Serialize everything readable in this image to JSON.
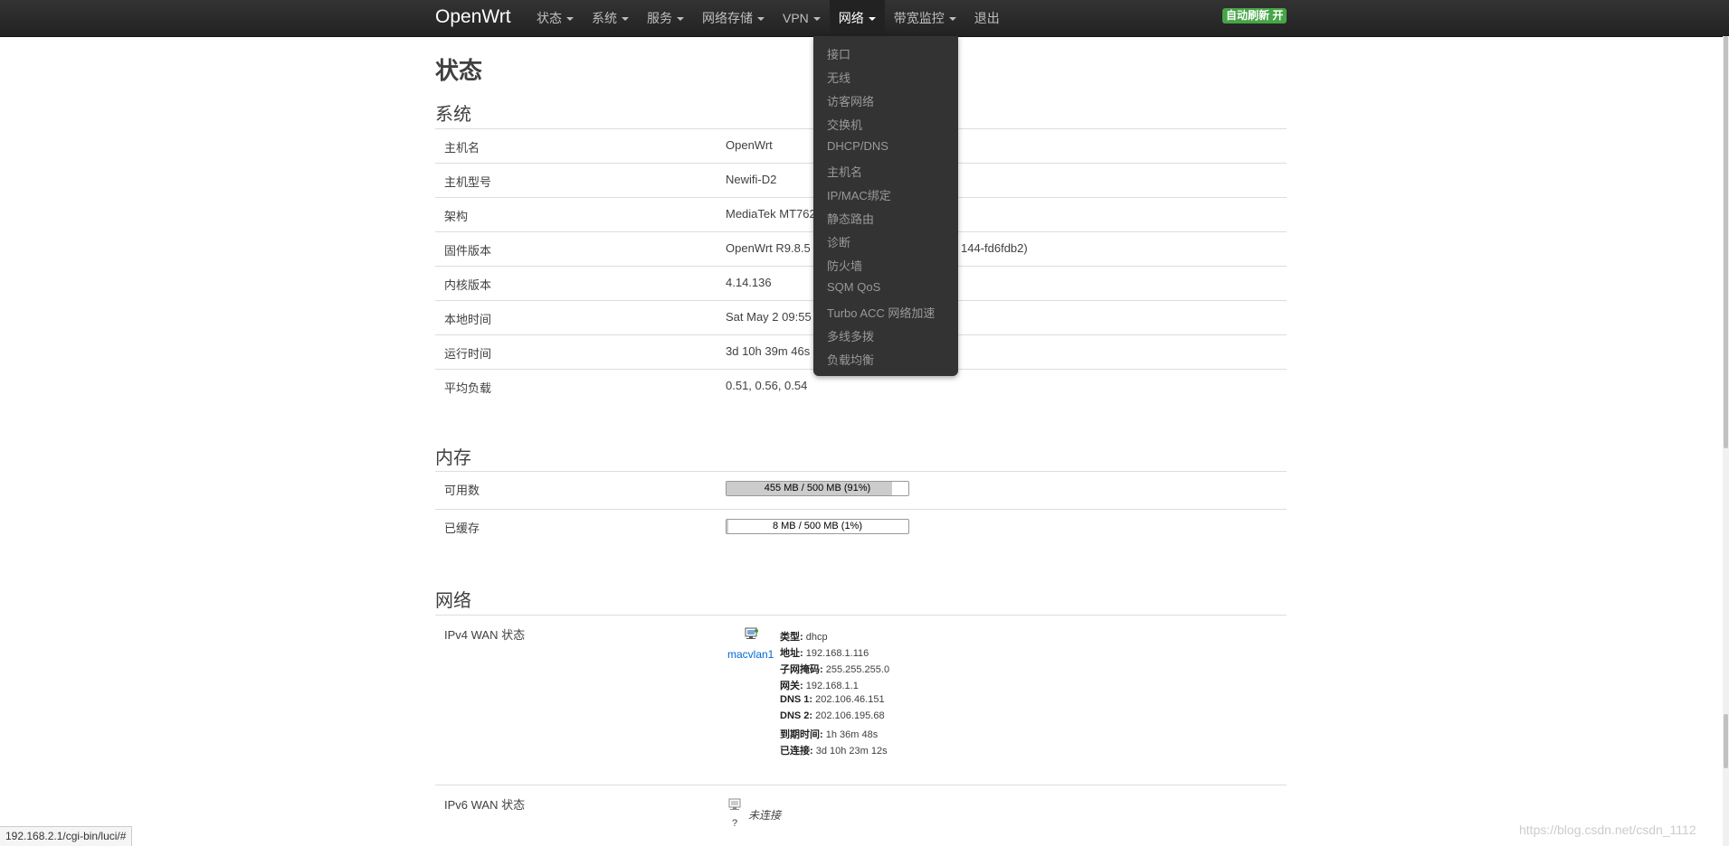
{
  "navbar": {
    "brand": "OpenWrt",
    "menu": [
      {
        "label": "状态",
        "has_caret": true
      },
      {
        "label": "系统",
        "has_caret": true
      },
      {
        "label": "服务",
        "has_caret": true
      },
      {
        "label": "网络存储",
        "has_caret": true
      },
      {
        "label": "VPN",
        "has_caret": true
      },
      {
        "label": "网络",
        "has_caret": true,
        "active": true
      },
      {
        "label": "带宽监控",
        "has_caret": true
      },
      {
        "label": "退出",
        "has_caret": false
      }
    ],
    "auto_refresh_badge": "自动刷新 开"
  },
  "network_dropdown": {
    "items": [
      "接口",
      "无线",
      "访客网络",
      "交换机",
      "DHCP/DNS",
      "主机名",
      "IP/MAC绑定",
      "静态路由",
      "诊断",
      "防火墙",
      "SQM QoS",
      "Turbo ACC 网络加速",
      "多线多拨",
      "负载均衡"
    ]
  },
  "page": {
    "title": "状态",
    "system": {
      "heading": "系统",
      "rows": [
        {
          "label": "主机名",
          "value": "OpenWrt"
        },
        {
          "label": "主机型号",
          "value": "Newifi-D2"
        },
        {
          "label": "架构",
          "value": "MediaTek MT762"
        },
        {
          "label": "固件版本",
          "value": "OpenWrt R9.8.5",
          "value_tail": "144-fd6fdb2)"
        },
        {
          "label": "内核版本",
          "value": "4.14.136"
        },
        {
          "label": "本地时间",
          "value": "Sat May 2 09:55"
        },
        {
          "label": "运行时间",
          "value": "3d 10h 39m 46s"
        },
        {
          "label": "平均负载",
          "value": "0.51, 0.56, 0.54"
        }
      ]
    },
    "memory": {
      "heading": "内存",
      "rows": [
        {
          "label": "可用数",
          "bar_text": "455 MB / 500 MB (91%)",
          "fraction": 0.91
        },
        {
          "label": "已缓存",
          "bar_text": "8 MB / 500 MB (1%)",
          "fraction": 0.01
        }
      ]
    },
    "network": {
      "heading": "网络",
      "ipv4_label": "IPv4 WAN 状态",
      "ipv4_interface": "macvlan1",
      "ipv4_details": [
        {
          "key": "类型:",
          "value": "dhcp"
        },
        {
          "key": "地址:",
          "value": "192.168.1.116"
        },
        {
          "key": "子网掩码:",
          "value": "255.255.255.0"
        },
        {
          "key": "网关:",
          "value": "192.168.1.1"
        },
        {
          "key": "DNS 1:",
          "value": "202.106.46.151"
        },
        {
          "key": "DNS 2:",
          "value": "202.106.195.68"
        },
        {
          "key": "到期时间:",
          "value": "1h 36m 48s"
        },
        {
          "key": "已连接:",
          "value": "3d 10h 23m 12s"
        }
      ],
      "ipv6_label": "IPv6 WAN 状态",
      "ipv6_status": "未连接",
      "ipv6_interface": "?"
    }
  },
  "statusbar": {
    "url": "192.168.2.1/cgi-bin/luci/#"
  },
  "watermark": "https://blog.csdn.net/csdn_1112"
}
